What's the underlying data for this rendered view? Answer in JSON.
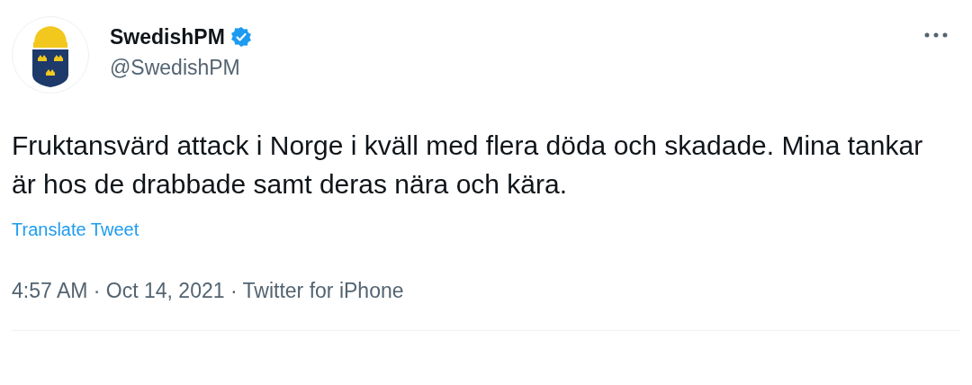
{
  "tweet": {
    "author": {
      "name": "SwedishPM",
      "verified": true,
      "handle": "@SwedishPM"
    },
    "text": "Fruktansvärd attack i Norge i kväll med flera döda och skadade. Mina tankar är hos de drabbade samt deras nära och kära.",
    "translate_link": "Translate Tweet",
    "meta": "4:57 AM · Oct 14, 2021 · Twitter for iPhone"
  }
}
